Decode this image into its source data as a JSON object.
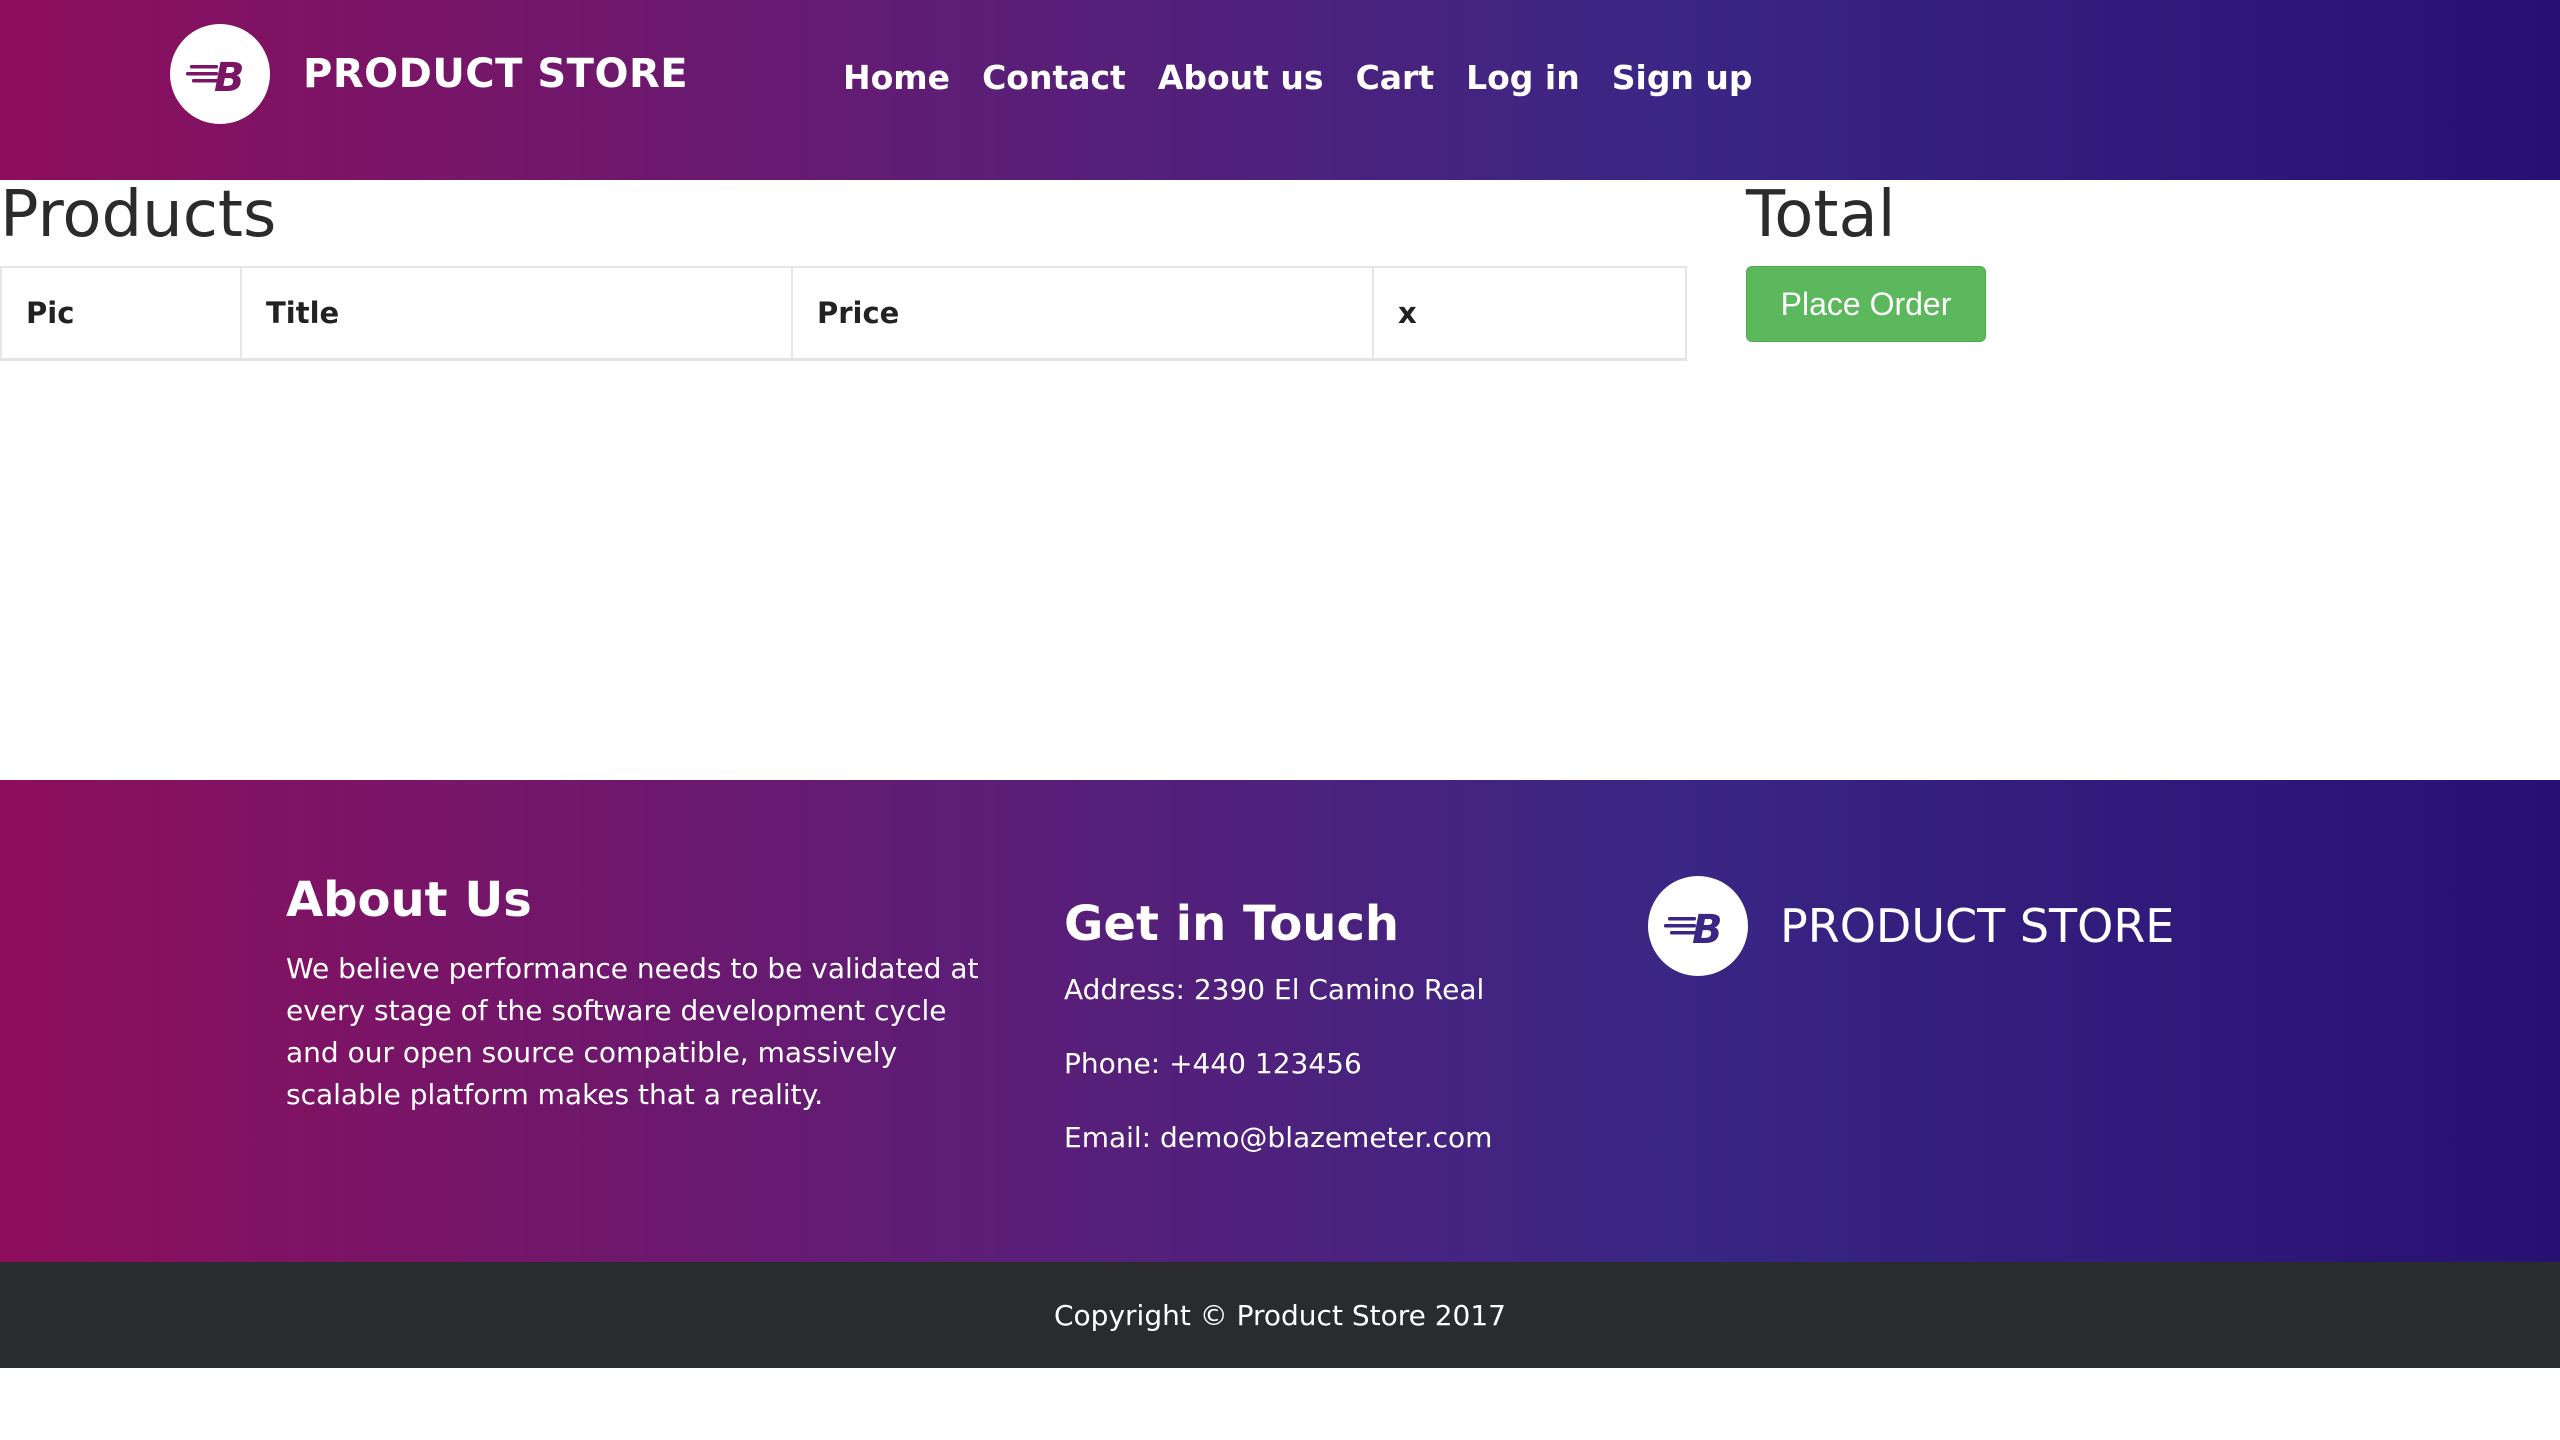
{
  "header": {
    "brand": "PRODUCT STORE",
    "logo_icon": "blazemeter-b-logo-icon",
    "nav": [
      "Home",
      "Contact",
      "About us",
      "Cart",
      "Log in",
      "Sign up"
    ]
  },
  "cart": {
    "products_heading": "Products",
    "columns": [
      "Pic",
      "Title",
      "Price",
      "x"
    ],
    "total_heading": "Total",
    "place_order_label": "Place Order"
  },
  "footer": {
    "about_title": "About Us",
    "about_text": "We believe performance needs to be validated at every stage of the software development cycle and our open source compatible, massively scalable platform makes that a reality.",
    "touch_title": "Get in Touch",
    "address": "Address: 2390 El Camino Real",
    "phone": "Phone: +440 123456",
    "email": "Email: demo@blazemeter.com",
    "brand": "PRODUCT STORE",
    "copyright": "Copyright © Product Store 2017"
  },
  "colors": {
    "gradient_start": "#8e0e5c",
    "gradient_end": "#271073",
    "success_button": "#5cb85c",
    "copyright_bar": "#2a2b2e"
  }
}
